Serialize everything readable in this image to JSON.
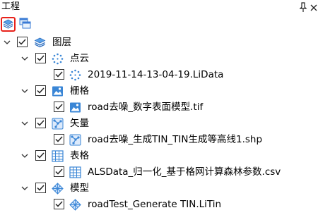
{
  "panel": {
    "title": "工程",
    "pin_icon": "pin-icon",
    "close_icon": "close-icon"
  },
  "toolbar": {
    "buttons": [
      {
        "icon": "layers-icon",
        "active": true
      },
      {
        "icon": "windows-icon",
        "active": false
      }
    ]
  },
  "tree": {
    "root": {
      "label": "图层",
      "checked": true,
      "expanded": true,
      "icon": "layers-icon"
    },
    "groups": [
      {
        "label": "点云",
        "checked": true,
        "expanded": true,
        "icon": "point-cloud-icon",
        "child": {
          "label": "2019-11-14-13-04-19.LiData",
          "checked": true,
          "icon": "point-cloud-icon"
        }
      },
      {
        "label": "栅格",
        "checked": true,
        "expanded": true,
        "icon": "raster-icon",
        "child": {
          "label": "road去噪_数字表面模型.tif",
          "checked": true,
          "icon": "raster-icon"
        }
      },
      {
        "label": "矢量",
        "checked": true,
        "expanded": true,
        "icon": "vector-icon",
        "child": {
          "label": "road去噪_生成TIN_TIN生成等高线1.shp",
          "checked": true,
          "icon": "vector-icon"
        }
      },
      {
        "label": "表格",
        "checked": true,
        "expanded": true,
        "icon": "table-icon",
        "child": {
          "label": "ALSData_归一化_基于格网计算森林参数.csv",
          "checked": true,
          "icon": "table-icon"
        }
      },
      {
        "label": "模型",
        "checked": true,
        "expanded": true,
        "icon": "model-icon",
        "child": {
          "label": "roadTest_Generate TIN.LiTin",
          "checked": true,
          "icon": "model-icon"
        }
      }
    ]
  },
  "colors": {
    "accent": "#2e74d6",
    "active_border": "#e8221b",
    "checkbox_border": "#333333",
    "folder_blue": "#4a90e2"
  }
}
